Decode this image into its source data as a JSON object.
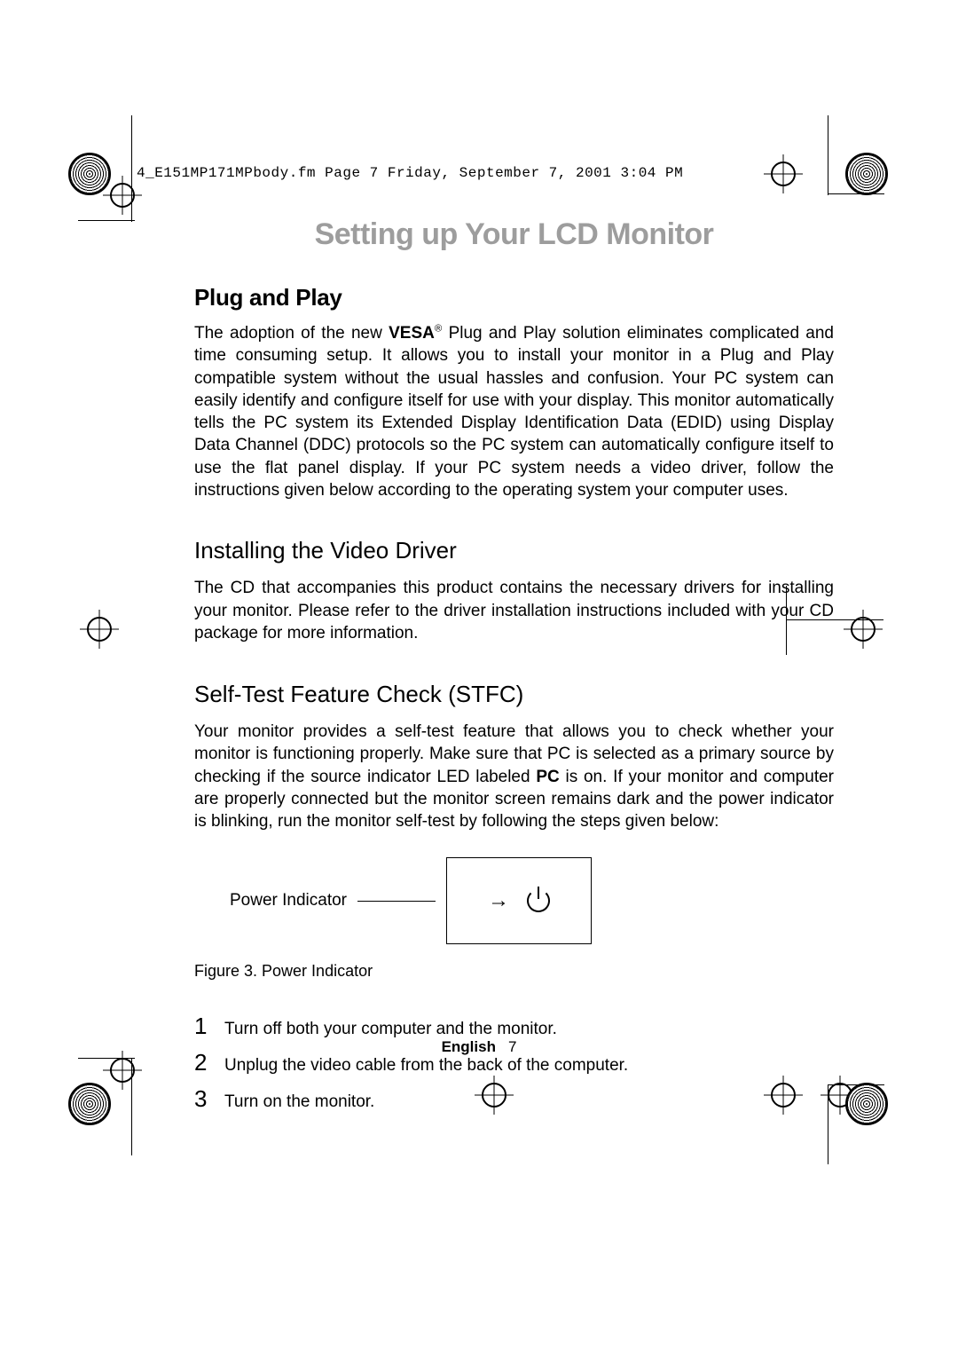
{
  "running_head": "4_E151MP171MPbody.fm  Page 7  Friday, September 7, 2001  3:04 PM",
  "chapter_title": "Setting up Your LCD Monitor",
  "sections": [
    {
      "heading": "Plug and Play",
      "vesa": "VESA",
      "body_parts": [
        "The adoption of the new ",
        " Plug and Play solution eliminates complicated and time consuming setup. It allows you to install your monitor in a Plug and Play compatible system without the usual hassles and confusion. Your PC system can easily identify and configure itself for use with your display. This monitor automatically tells the PC system its Extended Display Identification Data (EDID) using Display Data Channel (DDC) protocols so the PC system can automatically configure itself to use the flat panel display. If your PC system needs a video driver, follow the instructions given below according to the operating system your computer uses."
      ]
    },
    {
      "heading": "Installing the Video Driver",
      "body": "The CD that accompanies this product contains the necessary drivers for installing your monitor. Please refer to the driver installation instructions included with your CD package for more information."
    },
    {
      "heading": "Self-Test Feature Check (STFC)",
      "pc_label": "PC",
      "body_parts": [
        "Your monitor provides a self-test feature that allows you to check whether your monitor is functioning properly. Make sure that PC is selected as a primary source by checking if the source indicator LED labeled ",
        " is on. If your monitor and computer are properly connected but the monitor screen remains dark and the power indicator is blinking, run the monitor self-test by following the steps given below:"
      ]
    }
  ],
  "figure": {
    "label": "Power Indicator",
    "caption": "Figure 3. Power Indicator"
  },
  "steps": [
    {
      "num": "1",
      "text": "Turn off both your computer and the monitor."
    },
    {
      "num": "2",
      "text": "Unplug the video cable from the back of the computer."
    },
    {
      "num": "3",
      "text": "Turn on the monitor."
    }
  ],
  "footer": {
    "language": "English",
    "page": "7"
  }
}
